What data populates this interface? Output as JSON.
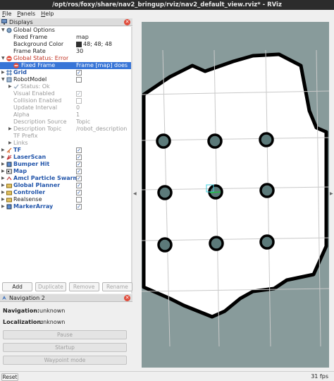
{
  "window": {
    "title": "/opt/ros/foxy/share/nav2_bringup/rviz/nav2_default_view.rviz* - RViz"
  },
  "menu": {
    "file": "File",
    "file_key": "F",
    "file_rest": "ile",
    "panels_key": "P",
    "panels_rest": "anels",
    "help_key": "H",
    "help_rest": "elp"
  },
  "displays": {
    "title": "Displays",
    "global_options": "Global Options",
    "fixed_frame": {
      "label": "Fixed Frame",
      "value": "map"
    },
    "background_color": {
      "label": "Background Color",
      "value": "48; 48; 48",
      "swatch": "#303030"
    },
    "frame_rate": {
      "label": "Frame Rate",
      "value": "30"
    },
    "global_status": "Global Status: Error",
    "status_fixed_frame": {
      "label": "Fixed Frame",
      "value": "Frame [map] does ..."
    },
    "grid": "Grid",
    "robot_model": {
      "label": "RobotModel",
      "status": "Status: Ok",
      "visual_enabled": "Visual Enabled",
      "collision_enabled": "Collision Enabled",
      "update_interval": {
        "label": "Update Interval",
        "value": "0"
      },
      "alpha": {
        "label": "Alpha",
        "value": "1"
      },
      "description_source": {
        "label": "Description Source",
        "value": "Topic"
      },
      "description_topic": {
        "label": "Description Topic",
        "value": "/robot_description"
      },
      "tf_prefix": "TF Prefix",
      "links": "Links"
    },
    "tf": "TF",
    "laser_scan": "LaserScan",
    "bumper_hit": "Bumper Hit",
    "map": "Map",
    "amcl": "Amcl Particle Swarm",
    "global_planner": "Global Planner",
    "controller": "Controller",
    "realsense": "Realsense",
    "marker_array": "MarkerArray"
  },
  "buttons": {
    "add": "Add",
    "duplicate": "Duplicate",
    "remove": "Remove",
    "rename": "Rename"
  },
  "navigation": {
    "title": "Navigation 2",
    "nav_label": "Navigation:",
    "nav_value": "unknown",
    "loc_label": "Localization:",
    "loc_value": "unknown",
    "pause": "Pause",
    "startup": "Startup",
    "waypoint": "Waypoint mode"
  },
  "status": {
    "reset": "Reset",
    "fps": "31 fps"
  },
  "colors": {
    "selection": "#3875d7",
    "error": "#e04b3a",
    "map_bg": "#889b9b",
    "obstacle": "#000000",
    "free": "#ffffff",
    "pillar": "#5c7a7a"
  }
}
